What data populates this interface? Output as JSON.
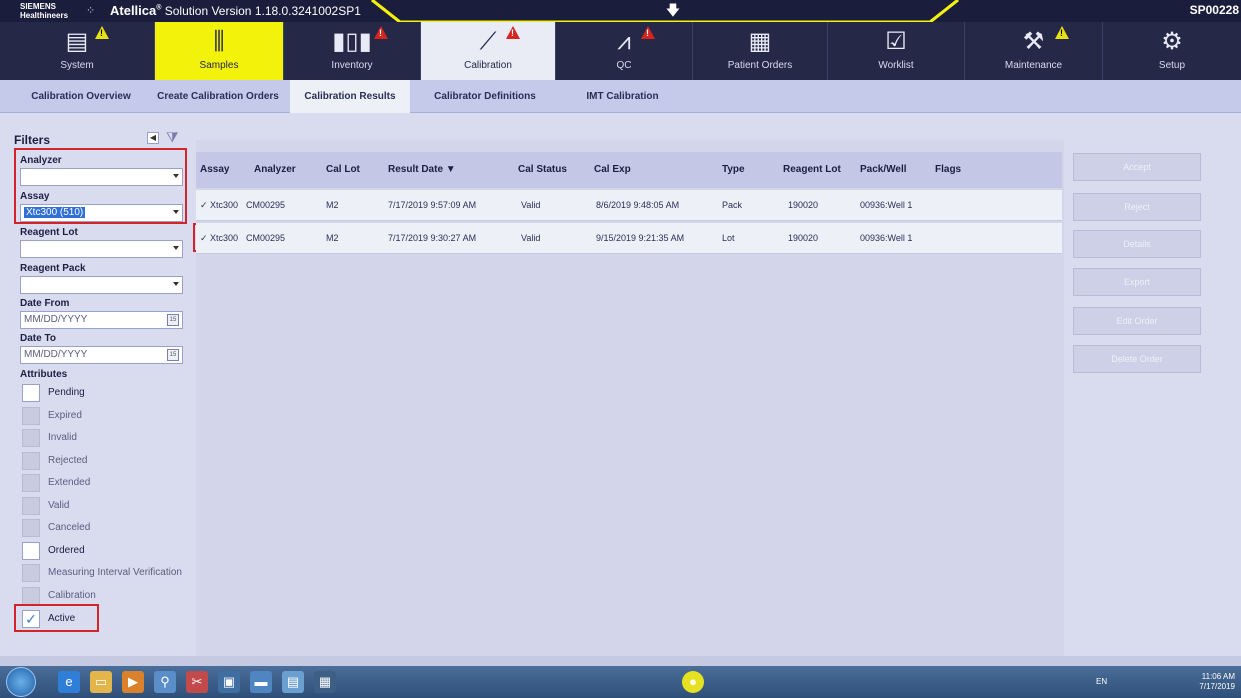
{
  "header": {
    "brand_line1": "SIEMENS",
    "brand_line2": "Healthineers",
    "app_name": "Atellica",
    "app_sup": "®",
    "app_version": " Solution  Version 1.18.0.3241002SP1",
    "system_id": "SP00228"
  },
  "nav": {
    "tabs": [
      {
        "label": "System",
        "icon": "system-icon",
        "warning": "yellow"
      },
      {
        "label": "Samples",
        "icon": "samples-icon",
        "highlighted": true
      },
      {
        "label": "Inventory",
        "icon": "inventory-icon",
        "warning": "red"
      },
      {
        "label": "Calibration",
        "icon": "calibration-icon",
        "warning": "red",
        "active": true
      },
      {
        "label": "QC",
        "icon": "qc-icon",
        "warning": "red"
      },
      {
        "label": "Patient Orders",
        "icon": "patient-orders-icon"
      },
      {
        "label": "Worklist",
        "icon": "worklist-icon"
      },
      {
        "label": "Maintenance",
        "icon": "maintenance-icon",
        "warning": "yellow"
      },
      {
        "label": "Setup",
        "icon": "setup-icon"
      }
    ]
  },
  "subnav": {
    "tabs": [
      {
        "label": "Calibration Overview"
      },
      {
        "label": "Create Calibration Orders"
      },
      {
        "label": "Calibration Results",
        "active": true
      },
      {
        "label": "Calibrator Definitions"
      },
      {
        "label": "IMT Calibration"
      }
    ]
  },
  "filters": {
    "title": "Filters",
    "analyzer_label": "Analyzer",
    "analyzer_value": "",
    "assay_label": "Assay",
    "assay_value": "Xtc300 (510)",
    "reagent_lot_label": "Reagent Lot",
    "reagent_lot_value": "",
    "reagent_pack_label": "Reagent Pack",
    "reagent_pack_value": "",
    "date_from_label": "Date From",
    "date_from_placeholder": "MM/DD/YYYY",
    "date_to_label": "Date To",
    "date_to_placeholder": "MM/DD/YYYY",
    "calendar_icon_text": "15",
    "attributes_label": "Attributes",
    "attributes": [
      {
        "label": "Pending",
        "state": "white"
      },
      {
        "label": "Expired",
        "state": "gray"
      },
      {
        "label": "Invalid",
        "state": "gray"
      },
      {
        "label": "Rejected",
        "state": "gray"
      },
      {
        "label": "Extended",
        "state": "gray"
      },
      {
        "label": "Valid",
        "state": "gray"
      },
      {
        "label": "Canceled",
        "state": "gray"
      },
      {
        "label": "Ordered",
        "state": "white"
      },
      {
        "label": "Measuring Interval Verification",
        "state": "gray"
      },
      {
        "label": "Calibration",
        "state": "gray"
      },
      {
        "label": "Active",
        "state": "checked"
      }
    ]
  },
  "table": {
    "headers": [
      "Assay",
      "Analyzer",
      "Cal Lot",
      "Result Date ▼",
      "Cal Status",
      "Cal Exp",
      "Type",
      "Reagent Lot",
      "Pack/Well",
      "Flags"
    ],
    "rows": [
      [
        "Xtc300",
        "CM00295",
        "M2",
        "7/17/2019 9:57:09 AM",
        "Valid",
        "8/6/2019 9:48:05 AM",
        "Pack",
        "190020",
        "00936:Well 1",
        ""
      ],
      [
        "Xtc300",
        "CM00295",
        "M2",
        "7/17/2019 9:30:27 AM",
        "Valid",
        "9/15/2019 9:21:35 AM",
        "Lot",
        "190020",
        "00936:Well 1",
        ""
      ]
    ],
    "check_mark": "✓"
  },
  "actions": {
    "buttons": [
      "Accept",
      "Reject",
      "Details",
      "Export",
      "Edit Order",
      "Delete Order"
    ]
  },
  "taskbar": {
    "lang": "EN",
    "time": "11:06 AM",
    "date": "7/17/2019"
  },
  "colors": {
    "titlebar": "#1b1d3d",
    "nav_bg": "#262848",
    "highlight_yellow": "#f2f20a",
    "red_annotation": "#d3242a",
    "selection_blue": "#2f6fd6"
  }
}
